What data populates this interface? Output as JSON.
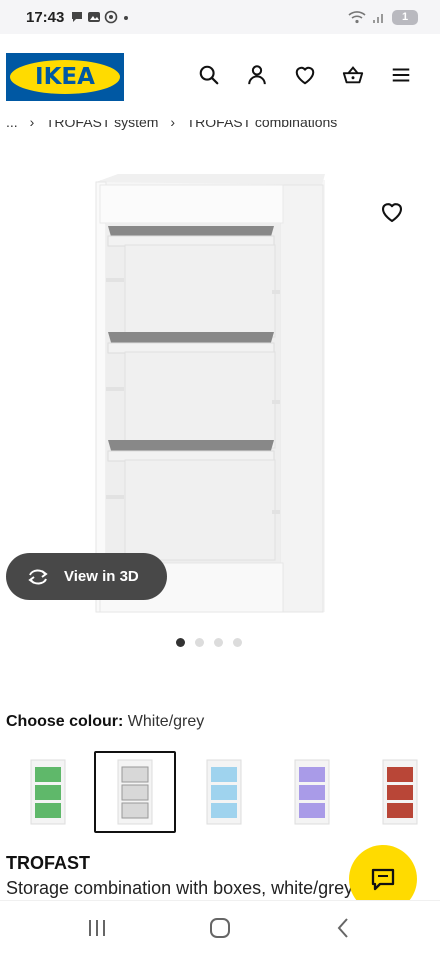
{
  "status_bar": {
    "time": "17:43",
    "notification_badge": "1"
  },
  "header": {
    "logo_text": "IKEA",
    "brand_blue": "#0058a3",
    "brand_yellow": "#ffdb00"
  },
  "breadcrumb": {
    "ellipsis": "...",
    "sep": "›",
    "items": [
      "TROFAST system",
      "TROFAST combinations"
    ]
  },
  "view3d": {
    "label": "View in 3D"
  },
  "gallery": {
    "count": 4,
    "active_index": 0
  },
  "colour": {
    "label": "Choose colour:",
    "value": "White/grey",
    "swatches": [
      {
        "name": "green",
        "color": "#5fb86a"
      },
      {
        "name": "white-grey",
        "color": "#d8d8d8",
        "selected": true
      },
      {
        "name": "light-blue",
        "color": "#9fd3ee"
      },
      {
        "name": "lilac",
        "color": "#a99be8"
      },
      {
        "name": "red",
        "color": "#b94637"
      }
    ]
  },
  "product": {
    "name": "TROFAST",
    "description": "Storage combination with boxes, white/grey"
  },
  "icons": [
    "search-icon",
    "user-icon",
    "heart-icon",
    "basket-icon",
    "menu-icon",
    "heart-outline-icon",
    "rotate-3d-icon",
    "chat-icon",
    "recents-icon",
    "home-icon",
    "back-icon"
  ]
}
